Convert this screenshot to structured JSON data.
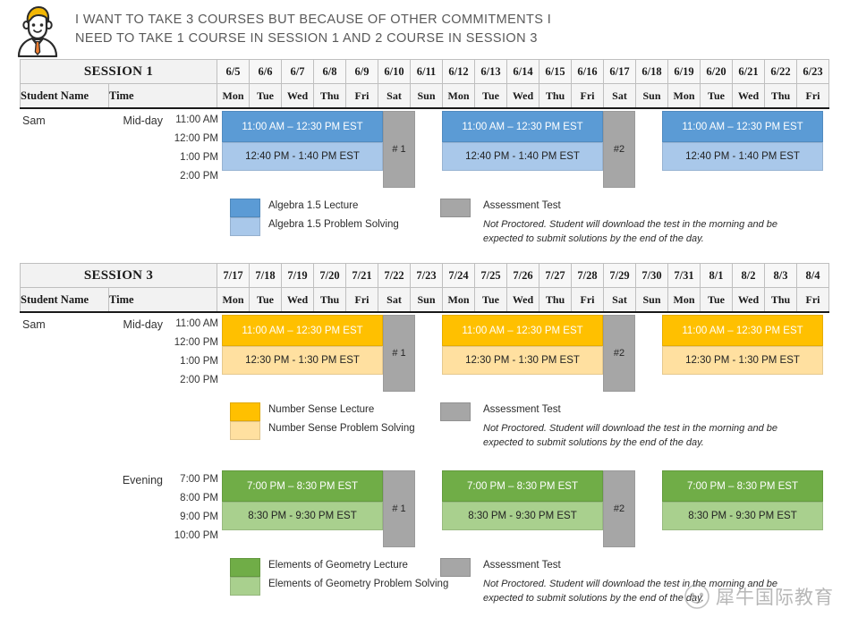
{
  "header": {
    "avatar_alt": "student-avatar",
    "line1": "I want to take 3 courses but because of other commitments I",
    "line2": "need to take 1 course in session 1 and 2 course in session 3"
  },
  "colors": {
    "blue_lecture": "#5B9BD5",
    "blue_problem": "#A9C8EA",
    "orange_lecture": "#FFC000",
    "orange_problem": "#FFE0A0",
    "green_lecture": "#70AD47",
    "green_problem": "#A9D08E",
    "test_gray": "#A6A6A6",
    "header_gray": "#F2F2F2",
    "text_dark": "#595959"
  },
  "sessions": [
    {
      "id": "session-1",
      "title": "SESSION 1",
      "col_student": "Student Name",
      "col_time": "Time",
      "dates": [
        "6/5",
        "6/6",
        "6/7",
        "6/8",
        "6/9",
        "6/10",
        "6/11",
        "6/12",
        "6/13",
        "6/14",
        "6/15",
        "6/16",
        "6/17",
        "6/18",
        "6/19",
        "6/20",
        "6/21",
        "6/22",
        "6/23"
      ],
      "days": [
        "Mon",
        "Tue",
        "Wed",
        "Thu",
        "Fri",
        "Sat",
        "Sun",
        "Mon",
        "Tue",
        "Wed",
        "Thu",
        "Fri",
        "Sat",
        "Sun",
        "Mon",
        "Tue",
        "Wed",
        "Thu",
        "Fri"
      ],
      "rows": [
        {
          "student": "Sam",
          "daypart": "Mid-day",
          "hours": [
            "11:00 AM",
            "12:00 PM",
            "1:00 PM",
            "2:00 PM"
          ],
          "lecture_label": "11:00 AM – 12:30 PM EST",
          "problem_label": "12:40 PM - 1:40 PM EST",
          "tests": [
            "# 1",
            "#2"
          ]
        }
      ],
      "legend": {
        "lecture": "Algebra 1.5 Lecture",
        "problem": "Algebra 1.5 Problem Solving",
        "test": "Assessment Test",
        "note": "Not Proctored.  Student will download the test in the morning and be expected to submit solutions by the end of the day."
      }
    },
    {
      "id": "session-3",
      "title": "SESSION 3",
      "col_student": "Student Name",
      "col_time": "Time",
      "dates": [
        "7/17",
        "7/18",
        "7/19",
        "7/20",
        "7/21",
        "7/22",
        "7/23",
        "7/24",
        "7/25",
        "7/26",
        "7/27",
        "7/28",
        "7/29",
        "7/30",
        "7/31",
        "8/1",
        "8/2",
        "8/3",
        "8/4"
      ],
      "days": [
        "Mon",
        "Tue",
        "Wed",
        "Thu",
        "Fri",
        "Sat",
        "Sun",
        "Mon",
        "Tue",
        "Wed",
        "Thu",
        "Fri",
        "Sat",
        "Sun",
        "Mon",
        "Tue",
        "Wed",
        "Thu",
        "Fri"
      ],
      "rows": [
        {
          "student": "Sam",
          "daypart": "Mid-day",
          "hours": [
            "11:00 AM",
            "12:00 PM",
            "1:00 PM",
            "2:00 PM"
          ],
          "lecture_label": "11:00 AM – 12:30 PM EST",
          "problem_label": "12:30 PM - 1:30 PM EST",
          "tests": [
            "# 1",
            "#2"
          ]
        },
        {
          "student": "",
          "daypart": "Evening",
          "hours": [
            "7:00 PM",
            "8:00 PM",
            "9:00 PM",
            "10:00 PM"
          ],
          "lecture_label": "7:00 PM – 8:30 PM EST",
          "problem_label": "8:30 PM - 9:30 PM EST",
          "tests": [
            "# 1",
            "#2"
          ]
        }
      ],
      "legend": {
        "lecture": "Number Sense Lecture",
        "problem": "Number Sense Problem Solving",
        "test": "Assessment Test",
        "note": "Not Proctored.  Student will download the test in the morning and be expected to submit solutions by the end of the day."
      },
      "legend2": {
        "lecture": "Elements of Geometry Lecture",
        "problem": "Elements of Geometry Problem Solving",
        "test": "Assessment Test",
        "note": "Not Proctored.  Student will download the test in the morning and be expected to submit solutions by the end of the day."
      }
    }
  ],
  "watermark": {
    "text": "犀牛国际教育"
  }
}
